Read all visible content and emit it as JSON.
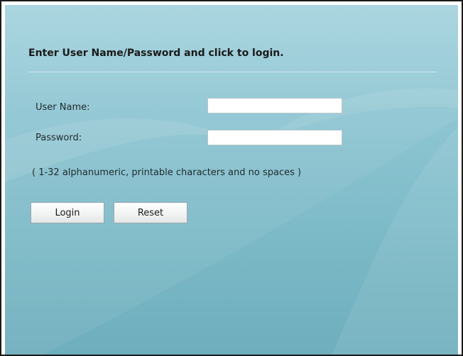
{
  "login_form": {
    "heading": "Enter User Name/Password and click to login.",
    "username_label": "User Name:",
    "username_value": "",
    "password_label": "Password:",
    "password_value": "",
    "hint": "( 1-32 alphanumeric, printable characters and no spaces )",
    "login_label": "Login",
    "reset_label": "Reset"
  },
  "colors": {
    "panel_background": "#8fc6d3",
    "heading_text": "#1a1a1a",
    "field_background": "#ffffff"
  }
}
